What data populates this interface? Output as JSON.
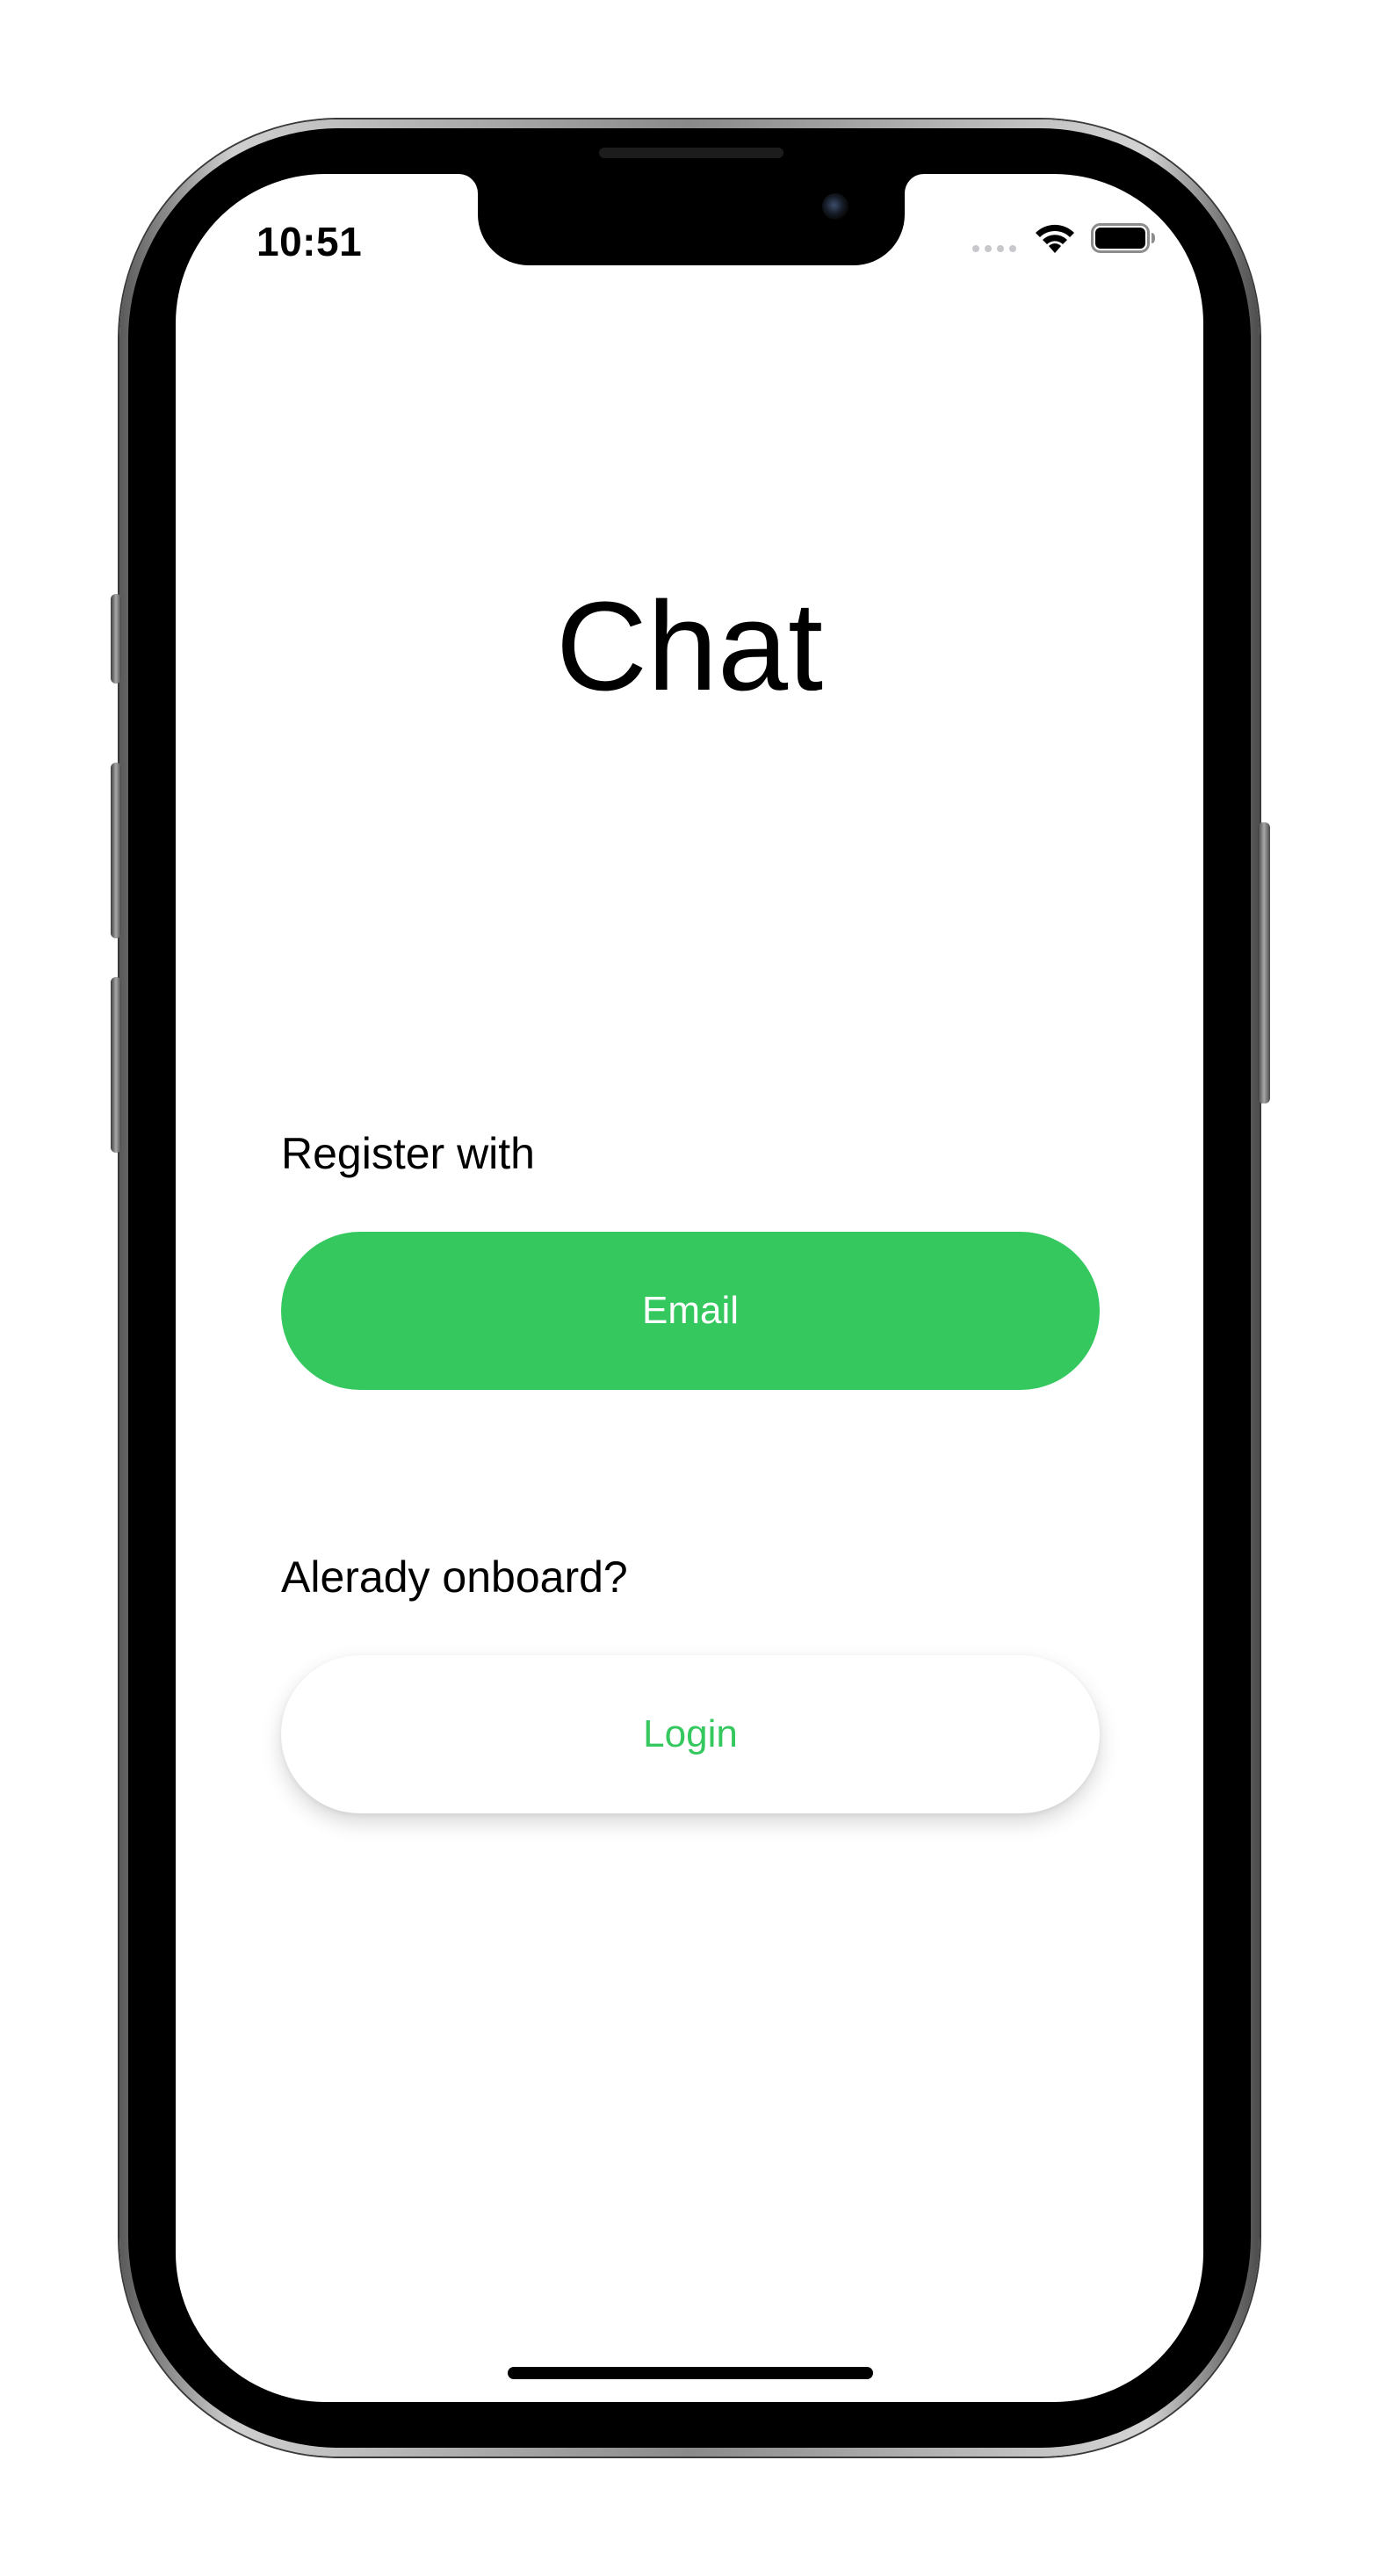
{
  "status_bar": {
    "time": "10:51",
    "icons": [
      "cellular-signal-icon",
      "wifi-icon",
      "battery-icon"
    ]
  },
  "app": {
    "title": "Chat"
  },
  "register": {
    "label": "Register with",
    "email_button_label": "Email"
  },
  "onboard": {
    "label": "Alerady onboard?",
    "login_button_label": "Login"
  },
  "colors": {
    "accent": "#34c85e",
    "background": "#ffffff",
    "text": "#000000"
  }
}
